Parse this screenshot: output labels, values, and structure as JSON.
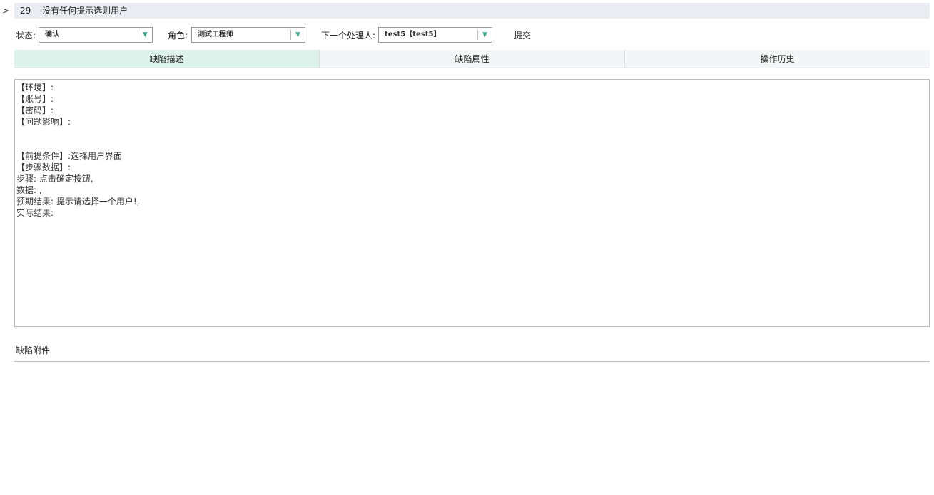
{
  "header": {
    "expand": ">",
    "id": "29",
    "title": "没有任何提示选则用户"
  },
  "form": {
    "status_label": "状态:",
    "status_value": "确认",
    "role_label": "角色:",
    "role_value": "测试工程师",
    "next_label": "下一个处理人:",
    "next_value": "test5【test5】",
    "submit_label": "提交"
  },
  "tabs": [
    "缺陷描述",
    "缺陷属性",
    "操作历史"
  ],
  "description": "【环境】:\n【账号】:\n【密码】:\n【问题影响】:\n\n\n【前提条件】:选择用户界面\n【步骤数据】:\n步骤: 点击确定按钮,\n数据: ,\n预期结果: 提示请选择一个用户!,\n实际结果:",
  "attachments_label": "缺陷附件",
  "colors": {
    "accent": "#3aa58a",
    "active_tab": "#dcf2ea",
    "titlebar": "#e9ecf1"
  }
}
